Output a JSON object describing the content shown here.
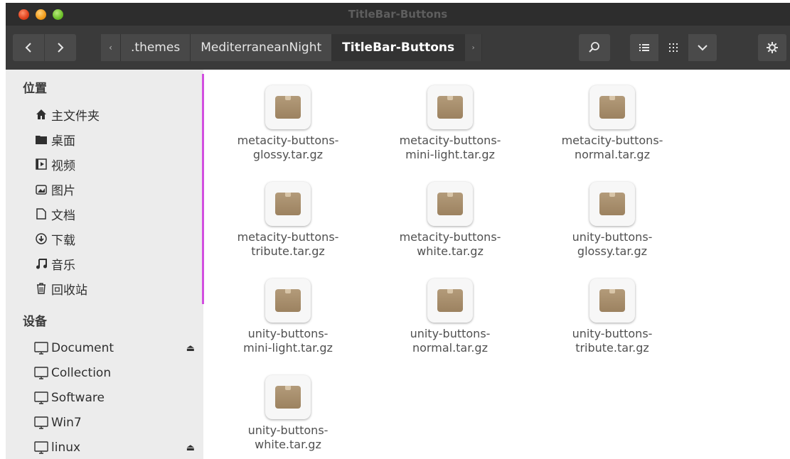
{
  "window": {
    "title": "TitleBar-Buttons"
  },
  "toolbar": {
    "back_icon": "chevron-left-icon",
    "forward_icon": "chevron-right-icon",
    "breadcrumb_left_arrow": "‹",
    "breadcrumbs": [
      ".themes",
      "MediterraneanNight",
      "TitleBar-Buttons"
    ],
    "breadcrumb_right_arrow": "›",
    "search_icon": "search-icon",
    "list_view_icon": "list-icon",
    "grid_view_icon": "grid-icon",
    "more_icon": "chevron-down-icon",
    "settings_icon": "gear-icon"
  },
  "sidebar": {
    "places_title": "位置",
    "places": [
      {
        "label": "主文件夹",
        "icon": "home-icon"
      },
      {
        "label": "桌面",
        "icon": "desktop-folder-icon"
      },
      {
        "label": "视频",
        "icon": "video-icon"
      },
      {
        "label": "图片",
        "icon": "picture-icon"
      },
      {
        "label": "文档",
        "icon": "document-icon"
      },
      {
        "label": "下载",
        "icon": "download-icon"
      },
      {
        "label": "音乐",
        "icon": "music-icon"
      },
      {
        "label": "回收站",
        "icon": "trash-icon"
      }
    ],
    "devices_title": "设备",
    "devices": [
      {
        "label": "Document",
        "icon": "drive-icon",
        "eject": true
      },
      {
        "label": "Collection",
        "icon": "drive-icon",
        "eject": false
      },
      {
        "label": "Software",
        "icon": "drive-icon",
        "eject": false
      },
      {
        "label": "Win7",
        "icon": "drive-icon",
        "eject": false
      },
      {
        "label": "linux",
        "icon": "drive-icon",
        "eject": true
      }
    ]
  },
  "files": [
    {
      "line1": "metacity-buttons-",
      "line2": "glossy.tar.gz"
    },
    {
      "line1": "metacity-buttons-",
      "line2": "mini-light.tar.gz"
    },
    {
      "line1": "metacity-buttons-",
      "line2": "normal.tar.gz"
    },
    {
      "line1": "metacity-buttons-",
      "line2": "tribute.tar.gz"
    },
    {
      "line1": "metacity-buttons-",
      "line2": "white.tar.gz"
    },
    {
      "line1": "unity-buttons-",
      "line2": "glossy.tar.gz"
    },
    {
      "line1": "unity-buttons-",
      "line2": "mini-light.tar.gz"
    },
    {
      "line1": "unity-buttons-",
      "line2": "normal.tar.gz"
    },
    {
      "line1": "unity-buttons-",
      "line2": "tribute.tar.gz"
    },
    {
      "line1": "unity-buttons-",
      "line2": "white.tar.gz"
    }
  ],
  "colors": {
    "accent": "#d24fe0",
    "toolbar": "#3a3a3a",
    "sidebar": "#ececec"
  }
}
